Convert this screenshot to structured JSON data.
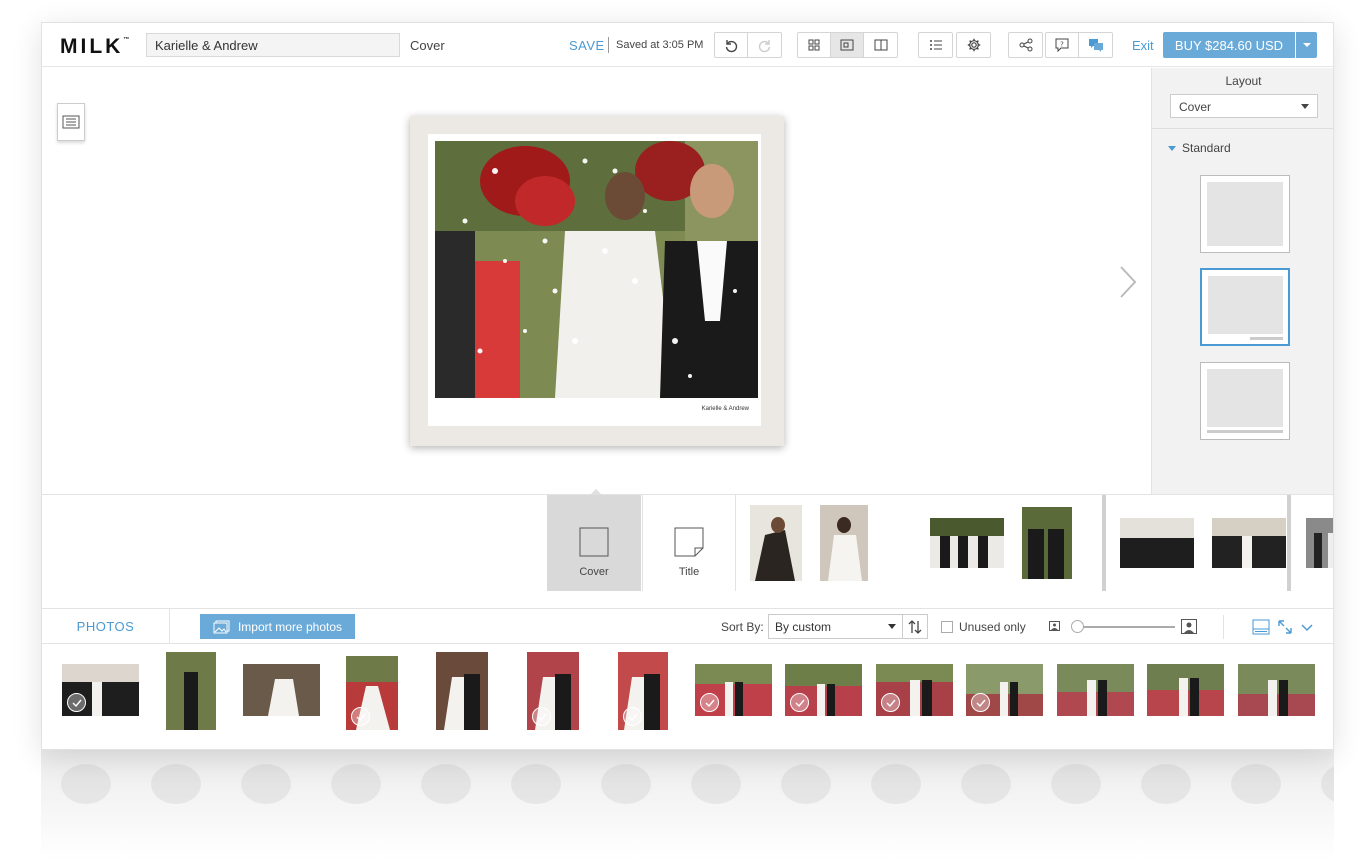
{
  "header": {
    "logo": "MILK",
    "logo_tm": "™",
    "project_title": "Karielle & Andrew",
    "page_name": "Cover",
    "save_label": "SAVE",
    "saved_status": "Saved at 3:05 PM",
    "exit_label": "Exit",
    "buy_label": "BUY $284.60 USD"
  },
  "album": {
    "caption": "Karielle & Andrew"
  },
  "layout_panel": {
    "heading": "Layout",
    "selected_layout": "Cover",
    "section": "Standard"
  },
  "page_strip": {
    "pages": [
      {
        "label": "Cover"
      },
      {
        "label": "Title"
      }
    ]
  },
  "photos_bar": {
    "tab_label": "PHOTOS",
    "import_label": "Import more photos",
    "sort_by_label": "Sort By:",
    "sort_value": "By custom",
    "unused_only_label": "Unused only"
  },
  "colors": {
    "accent": "#4a9ad4",
    "button": "#6aaad8"
  }
}
